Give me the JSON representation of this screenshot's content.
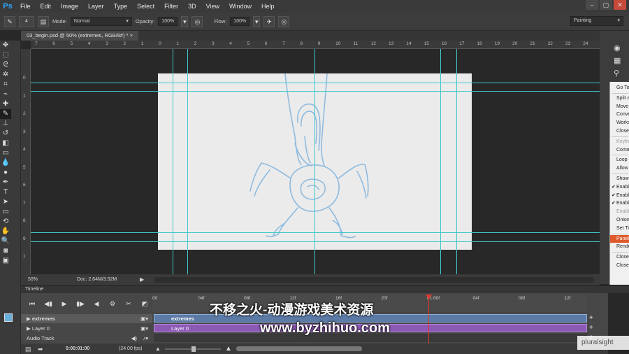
{
  "menubar": {
    "logo": "Ps",
    "items": [
      "File",
      "Edit",
      "Image",
      "Layer",
      "Type",
      "Select",
      "Filter",
      "3D",
      "View",
      "Window",
      "Help"
    ]
  },
  "options": {
    "brush_size": "4",
    "mode_label": "Mode:",
    "mode_value": "Normal",
    "opacity_label": "Opacity:",
    "opacity_value": "100%",
    "flow_label": "Flow:",
    "flow_value": "100%",
    "workspace": "Painting"
  },
  "document": {
    "tab_title": "03_begin.psd @ 50% (extremes, RGB/8#) *"
  },
  "ruler": {
    "top_ticks": [
      "7",
      "6",
      "5",
      "4",
      "3",
      "2",
      "1",
      "0",
      "1",
      "2",
      "3",
      "4",
      "5",
      "6",
      "7",
      "8",
      "9",
      "10",
      "11",
      "12",
      "13",
      "14",
      "15",
      "16",
      "17",
      "18",
      "19",
      "20",
      "21",
      "22",
      "23",
      "24"
    ],
    "left_ticks": [
      "0",
      "1",
      "2",
      "3",
      "4",
      "5",
      "6",
      "7",
      "8",
      "9",
      "1"
    ]
  },
  "status": {
    "zoom": "50%",
    "doc_info": "Doc: 2.64M/3.52M"
  },
  "flyout_menu": {
    "items": [
      {
        "label": "Go To",
        "state": "normal"
      },
      {
        "label": "Split at Playhead",
        "state": "normal"
      },
      {
        "label": "Move Layer",
        "state": "normal"
      },
      {
        "label": "Convert Frames",
        "state": "normal"
      },
      {
        "label": "Workspace",
        "state": "normal"
      },
      {
        "label": "Close Gaps",
        "state": "normal"
      },
      {
        "label": "Keyframe Interpolation",
        "state": "disabled"
      },
      {
        "label": "Comments",
        "state": "normal"
      },
      {
        "label": "Loop Playback",
        "state": "normal"
      },
      {
        "label": "Allow Frame Skipping",
        "state": "normal"
      },
      {
        "label": "Show",
        "state": "normal"
      },
      {
        "label": "Enable Timeline Shortcut Keys",
        "state": "checked"
      },
      {
        "label": "Enable Onion Skins",
        "state": "checked"
      },
      {
        "label": "Enable Auto-Scrolling",
        "state": "checked"
      },
      {
        "label": "Enable Timecode",
        "state": "disabled"
      },
      {
        "label": "Onion Skin Settings...",
        "state": "normal"
      },
      {
        "label": "Set Timeline Frame Rate...",
        "state": "normal"
      },
      {
        "label": "Panel Options...",
        "state": "highlight"
      },
      {
        "label": "Render Video...",
        "state": "normal"
      },
      {
        "label": "Close",
        "state": "normal"
      },
      {
        "label": "Close Tab Group",
        "state": "normal"
      }
    ]
  },
  "timeline": {
    "panel_title": "Timeline",
    "tracks": [
      {
        "name": "extremes",
        "clip": "extremes"
      },
      {
        "name": "Layer 0",
        "clip": "Layer 0"
      }
    ],
    "audio_label": "Audio Track",
    "ruler_labels": [
      "00",
      "04f",
      "08f",
      "12f",
      "16f",
      "20f",
      "01:00f",
      "04f",
      "08f",
      "12f"
    ],
    "timecode": "0:00:01:00",
    "fps": "(24.00 fps)"
  },
  "watermark": {
    "line1": "不移之火-动漫游戏美术资源",
    "line2": "www.byzhihuo.com",
    "brand": "pluralsight"
  },
  "colors": {
    "guide": "#40c8c8",
    "clip_blue": "#5b7aa5",
    "clip_purple": "#8c5ab4",
    "playhead": "#e0382b",
    "menu_highlight": "#e05a2b"
  }
}
